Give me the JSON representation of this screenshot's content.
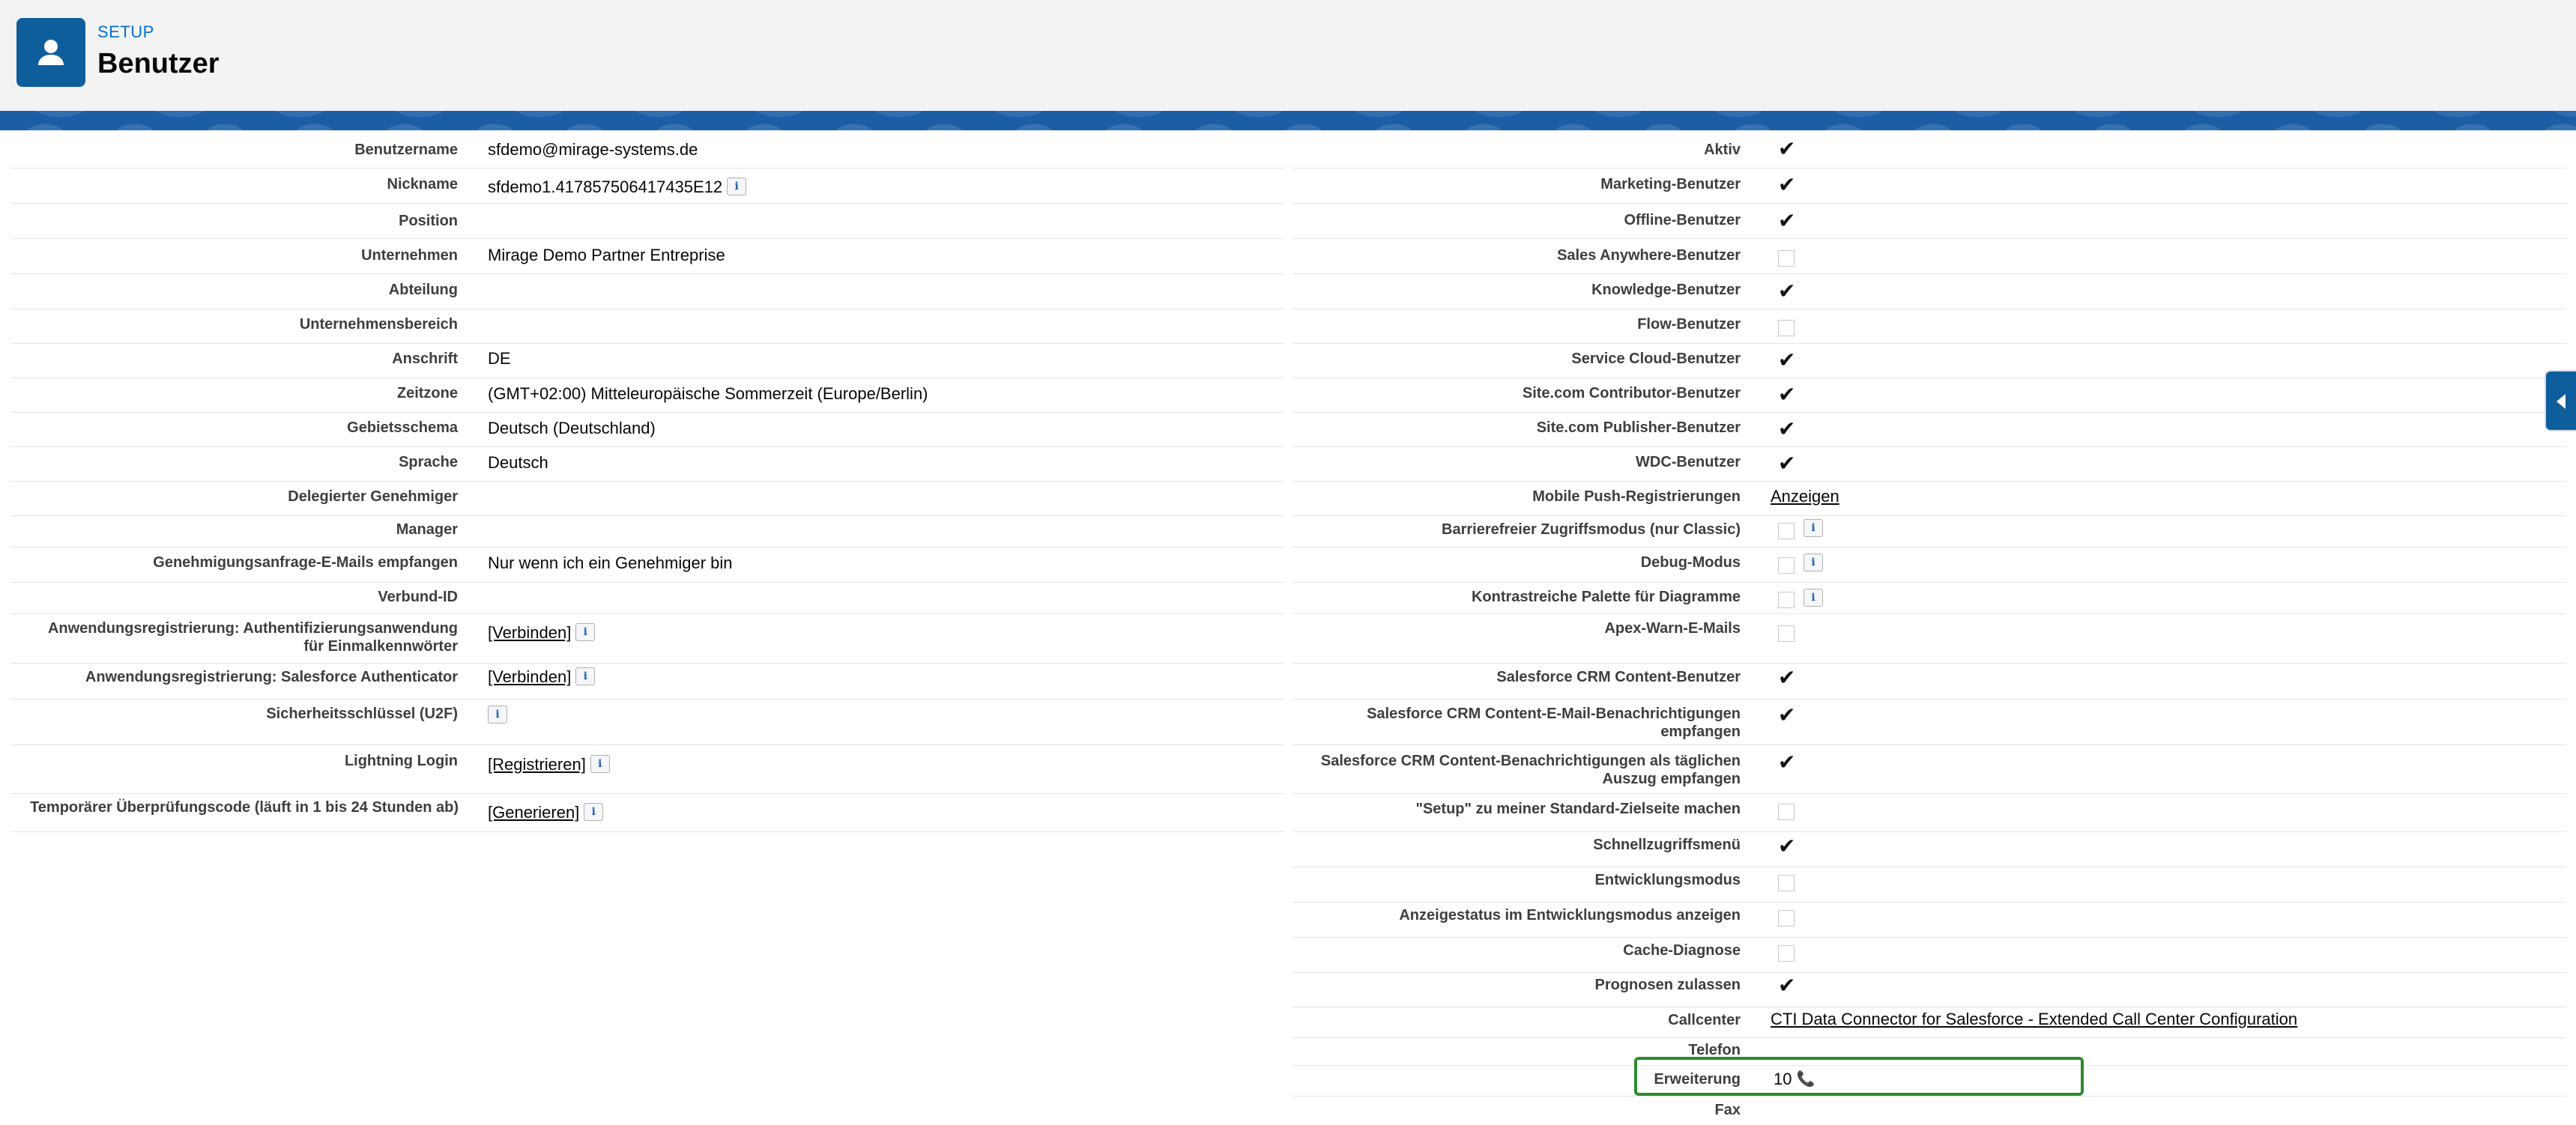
{
  "header": {
    "eyebrow": "SETUP",
    "title": "Benutzer",
    "icon": "user-icon",
    "icon_bg": "#0f5e9c"
  },
  "colors": {
    "banner": "#1b5ea6",
    "highlight_border": "#2e8b2e",
    "eyebrow": "#0070d2"
  },
  "left_fields": [
    {
      "label": "Benutzername",
      "value": "sfdemo@mirage-systems.de"
    },
    {
      "label": "Nickname",
      "value": "sfdemo1.417857506417435E12",
      "info": true
    },
    {
      "label": "Position",
      "value": ""
    },
    {
      "label": "Unternehmen",
      "value": "Mirage Demo Partner Entreprise"
    },
    {
      "label": "Abteilung",
      "value": ""
    },
    {
      "label": "Unternehmensbereich",
      "value": ""
    },
    {
      "label": "Anschrift",
      "value": "DE"
    },
    {
      "label": "Zeitzone",
      "value": "(GMT+02:00) Mitteleuropäische Sommerzeit (Europe/Berlin)"
    },
    {
      "label": "Gebietsschema",
      "value": "Deutsch (Deutschland)"
    },
    {
      "label": "Sprache",
      "value": "Deutsch"
    },
    {
      "label": "Delegierter Genehmiger",
      "value": ""
    },
    {
      "label": "Manager",
      "value": ""
    },
    {
      "label": "Genehmigungsanfrage-E-Mails empfangen",
      "value": "Nur wenn ich ein Genehmiger bin"
    },
    {
      "label": "Verbund-ID",
      "value": ""
    },
    {
      "label_line1": "Anwendungsregistrierung: Authentifizierungsanwendung",
      "label_line2": "für Einmalkennwörter",
      "link": "[Verbinden]",
      "info": true
    },
    {
      "label": "Anwendungsregistrierung: Salesforce Authenticator",
      "link": "[Verbinden]",
      "info": true
    },
    {
      "label": "Sicherheitsschlüssel (U2F)",
      "info": true
    },
    {
      "label": "Lightning Login",
      "link": "[Registrieren]",
      "info": true
    },
    {
      "label": "Temporärer Überprüfungscode (läuft in 1 bis 24 Stunden ab)",
      "link": "[Generieren]",
      "info": true
    }
  ],
  "right_fields": [
    {
      "label": "Aktiv",
      "checked": true
    },
    {
      "label": "Marketing-Benutzer",
      "checked": true
    },
    {
      "label": "Offline-Benutzer",
      "checked": true
    },
    {
      "label": "Sales Anywhere-Benutzer",
      "checked": false
    },
    {
      "label": "Knowledge-Benutzer",
      "checked": true
    },
    {
      "label": "Flow-Benutzer",
      "checked": false
    },
    {
      "label": "Service Cloud-Benutzer",
      "checked": true
    },
    {
      "label": "Site.com Contributor-Benutzer",
      "checked": true
    },
    {
      "label": "Site.com Publisher-Benutzer",
      "checked": true
    },
    {
      "label": "WDC-Benutzer",
      "checked": true
    },
    {
      "label": "Mobile Push-Registrierungen",
      "link": "Anzeigen"
    },
    {
      "label": "Barrierefreier Zugriffsmodus (nur Classic)",
      "checked": false,
      "info": true
    },
    {
      "label": "Debug-Modus",
      "checked": false,
      "info": true
    },
    {
      "label": "Kontrastreiche Palette für Diagramme",
      "checked": false,
      "info": true
    },
    {
      "label": "Apex-Warn-E-Mails",
      "checked": false
    },
    {
      "label": "Salesforce CRM Content-Benutzer",
      "checked": true
    },
    {
      "label_line1": "Salesforce CRM Content-E-Mail-Benachrichtigungen",
      "label_line2": "empfangen",
      "checked": true
    },
    {
      "label_line1": "Salesforce CRM Content-Benachrichtigungen als täglichen",
      "label_line2": "Auszug empfangen",
      "checked": true
    },
    {
      "label": "\"Setup\" zu meiner Standard-Zielseite machen",
      "checked": false
    },
    {
      "label": "Schnellzugriffsmenü",
      "checked": true
    },
    {
      "label": "Entwicklungsmodus",
      "checked": false
    },
    {
      "label": "Anzeigestatus im Entwicklungsmodus anzeigen",
      "checked": false
    },
    {
      "label": "Cache-Diagnose",
      "checked": false
    },
    {
      "label": "Prognosen zulassen",
      "checked": true
    },
    {
      "label": "Callcenter",
      "link": "CTI Data Connector for Salesforce - Extended Call Center Configuration"
    },
    {
      "label": "Telefon",
      "value": ""
    },
    {
      "label": "Erweiterung",
      "value": "10",
      "phone_icon": true,
      "highlighted": true
    },
    {
      "label": "Fax",
      "value": ""
    }
  ],
  "side_panel": {
    "icon": "collapse-left-icon"
  }
}
